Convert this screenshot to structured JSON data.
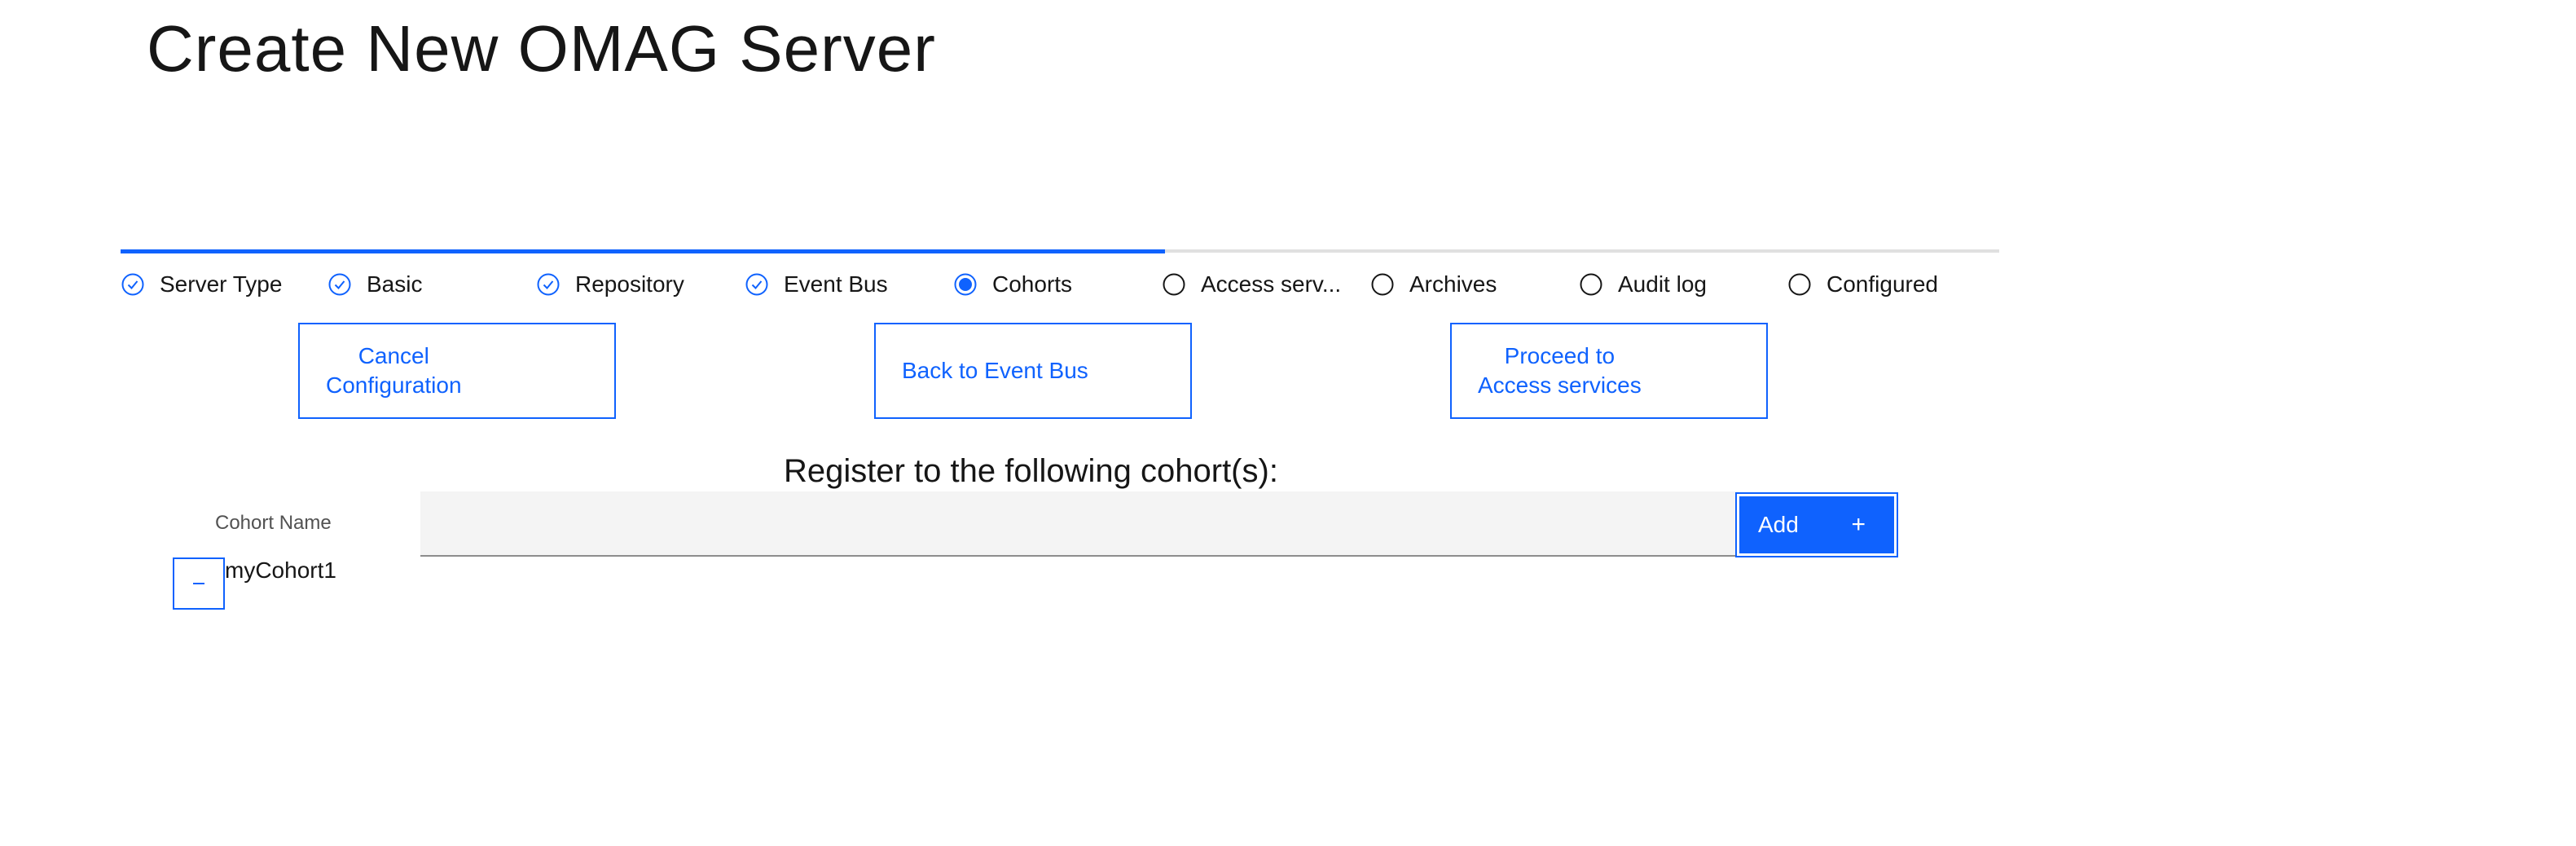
{
  "page": {
    "title": "Create New OMAG Server"
  },
  "progress": {
    "steps": [
      {
        "label": "Server Type",
        "state": "complete"
      },
      {
        "label": "Basic",
        "state": "complete"
      },
      {
        "label": "Repository",
        "state": "complete"
      },
      {
        "label": "Event Bus",
        "state": "complete"
      },
      {
        "label": "Cohorts",
        "state": "current"
      },
      {
        "label": "Access serv...",
        "state": "incomplete"
      },
      {
        "label": "Archives",
        "state": "incomplete"
      },
      {
        "label": "Audit log",
        "state": "incomplete"
      },
      {
        "label": "Configured",
        "state": "incomplete"
      }
    ]
  },
  "nav": {
    "cancel": {
      "line1": "Cancel",
      "line2": "Configuration"
    },
    "back": {
      "label": "Back to Event Bus"
    },
    "proceed": {
      "line1": "Proceed to",
      "line2": "Access services"
    }
  },
  "cohorts": {
    "heading": "Register to the following cohort(s):",
    "field_label": "Cohort Name",
    "input_value": "",
    "add_label": "Add",
    "add_icon": "+",
    "items": [
      {
        "name": "myCohort1"
      }
    ]
  },
  "colors": {
    "accent": "#0f62fe",
    "text": "#161616",
    "track": "#e0e0e0",
    "input_bg": "#f4f4f4"
  }
}
